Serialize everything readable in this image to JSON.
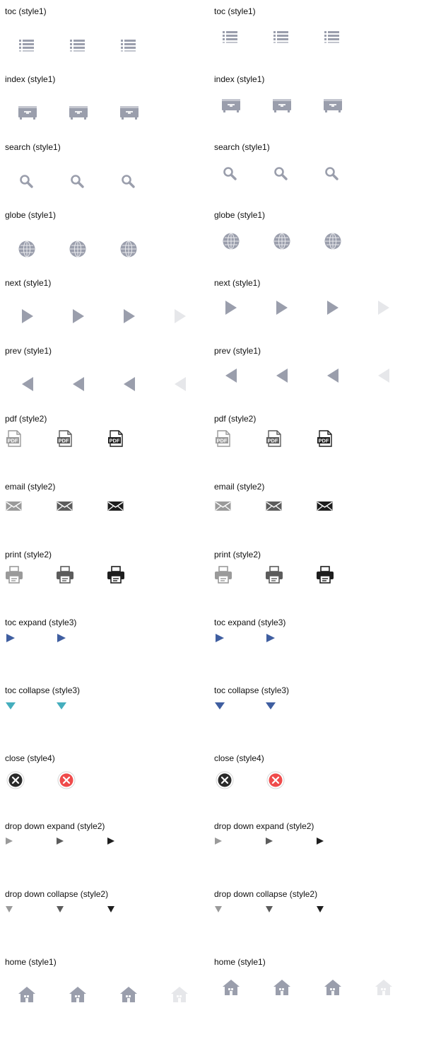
{
  "page": {
    "background": "#ffffff"
  },
  "columns": [
    {
      "name": "left",
      "sections": [
        {
          "label": "toc (style1)",
          "icon": "toc-icon",
          "states": 3
        },
        {
          "label": "index (style1)",
          "icon": "index-icon",
          "states": 3
        },
        {
          "label": "search (style1)",
          "icon": "search-icon",
          "states": 3
        },
        {
          "label": "globe (style1)",
          "icon": "globe-icon",
          "states": 3
        },
        {
          "label": "next (style1)",
          "icon": "next-icon",
          "states": 4
        },
        {
          "label": "prev (style1)",
          "icon": "prev-icon",
          "states": 4
        },
        {
          "label": "pdf (style2)",
          "icon": "pdf-icon",
          "states": 3
        },
        {
          "label": "email (style2)",
          "icon": "email-icon",
          "states": 3
        },
        {
          "label": "print (style2)",
          "icon": "print-icon",
          "states": 3
        },
        {
          "label": "toc expand (style3)",
          "icon": "toc-expand-icon",
          "states": 2
        },
        {
          "label": "toc collapse (style3)",
          "icon": "toc-collapse-icon",
          "states": 2
        },
        {
          "label": "close (style4)",
          "icon": "close-icon",
          "states": 2
        },
        {
          "label": "drop down expand (style2)",
          "icon": "dropdown-expand-icon",
          "states": 3
        },
        {
          "label": "drop down collapse (style2)",
          "icon": "dropdown-collapse-icon",
          "states": 3
        },
        {
          "label": "home (style1)",
          "icon": "home-icon",
          "states": 4
        }
      ]
    },
    {
      "name": "right",
      "sections": [
        {
          "label": "toc (style1)",
          "icon": "toc-icon",
          "states": 3
        },
        {
          "label": "index (style1)",
          "icon": "index-icon",
          "states": 3
        },
        {
          "label": "search (style1)",
          "icon": "search-icon",
          "states": 3
        },
        {
          "label": "globe (style1)",
          "icon": "globe-icon",
          "states": 3
        },
        {
          "label": "next (style1)",
          "icon": "next-icon",
          "states": 4
        },
        {
          "label": "prev (style1)",
          "icon": "prev-icon",
          "states": 4
        },
        {
          "label": "pdf (style2)",
          "icon": "pdf-icon",
          "states": 3
        },
        {
          "label": "email (style2)",
          "icon": "email-icon",
          "states": 3
        },
        {
          "label": "print (style2)",
          "icon": "print-icon",
          "states": 3
        },
        {
          "label": "toc expand (style3)",
          "icon": "toc-expand-icon",
          "states": 2
        },
        {
          "label": "toc collapse (style3)",
          "icon": "toc-collapse-icon",
          "states": 2
        },
        {
          "label": "close (style4)",
          "icon": "close-icon",
          "states": 2
        },
        {
          "label": "drop down expand (style2)",
          "icon": "dropdown-expand-icon",
          "states": 3
        },
        {
          "label": "drop down collapse (style2)",
          "icon": "dropdown-collapse-icon",
          "states": 3
        },
        {
          "label": "home (style1)",
          "icon": "home-icon",
          "states": 4
        }
      ]
    }
  ],
  "colors": {
    "style1_gray": "#9a9eac",
    "style1_light": "#e6e7ea",
    "style2_light": "#9a9a9a",
    "style2_mid": "#5c5c5c",
    "style2_dark": "#1e1e1e",
    "style3_blue": "#3f5ea0",
    "style3_teal": "#45aebd",
    "close_dark": "#2a2a2a",
    "close_red": "#ef4b4b"
  }
}
